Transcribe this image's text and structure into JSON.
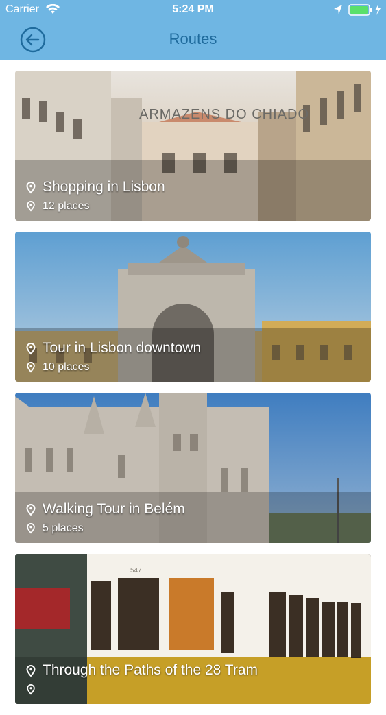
{
  "status_bar": {
    "carrier": "Carrier",
    "time": "5:24 PM",
    "icons": [
      "wifi-icon",
      "location-arrow-icon",
      "battery-icon",
      "charging-bolt-icon"
    ]
  },
  "navbar": {
    "title": "Routes",
    "back_icon": "back-arrow-circle-icon"
  },
  "routes": [
    {
      "name": "Shopping in Lisbon",
      "places": "12 places",
      "sign_text": "ARMAZENS DO CHIADO"
    },
    {
      "name": "Tour in Lisbon downtown",
      "places": "10 places"
    },
    {
      "name": "Walking Tour in Belém",
      "places": "5 places"
    },
    {
      "name": "Through the Paths of the 28 Tram",
      "places": "",
      "tram_number": "547"
    }
  ],
  "colors": {
    "header_bg": "#6fb6e3",
    "title_text": "#1f6b9d",
    "card_text": "#ffffff"
  }
}
